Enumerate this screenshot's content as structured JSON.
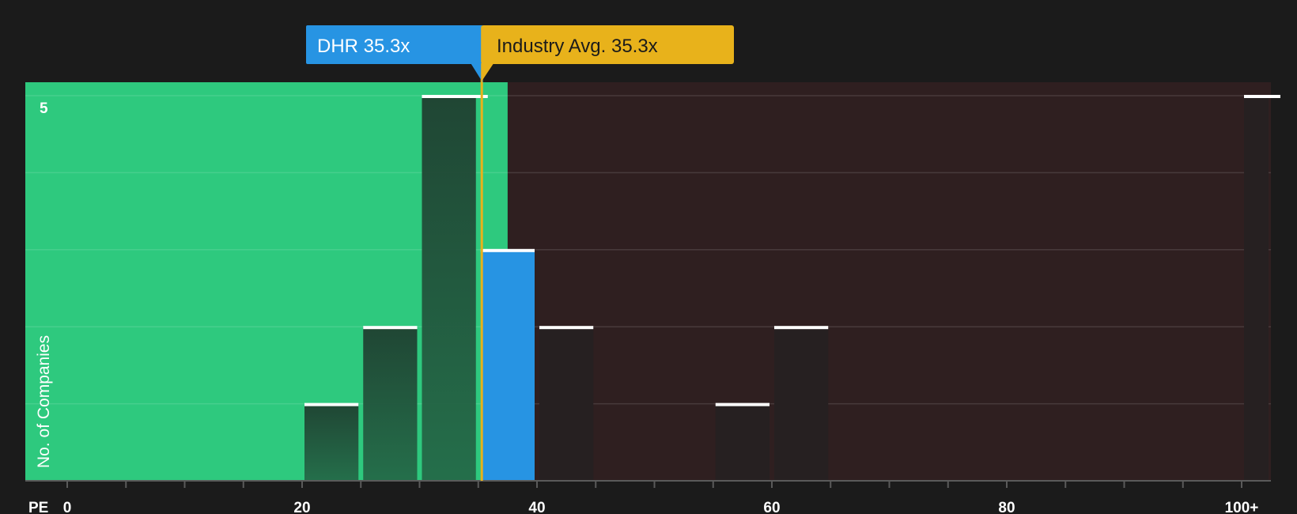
{
  "chart_data": {
    "type": "bar",
    "title": "",
    "xlabel": "PE",
    "ylabel": "No. of Companies",
    "xlim": [
      0,
      103
    ],
    "ylim": [
      0,
      5
    ],
    "x_ticks": [
      {
        "value": 0,
        "label": "0"
      },
      {
        "value": 20,
        "label": "20"
      },
      {
        "value": 40,
        "label": "40"
      },
      {
        "value": 60,
        "label": "60"
      },
      {
        "value": 80,
        "label": "80"
      },
      {
        "value": 100,
        "label": "100+"
      }
    ],
    "y_ticks": [
      {
        "value": 5,
        "label": "5"
      }
    ],
    "grid": true,
    "bin_width": 5,
    "bins": [
      {
        "start": 20,
        "end": 25,
        "count": 1
      },
      {
        "start": 25,
        "end": 30,
        "count": 2
      },
      {
        "start": 30,
        "end": 35,
        "count": 5
      },
      {
        "start": 35,
        "end": 40,
        "count": 3,
        "highlight": true
      },
      {
        "start": 40,
        "end": 45,
        "count": 2
      },
      {
        "start": 55,
        "end": 60,
        "count": 1
      },
      {
        "start": 60,
        "end": 65,
        "count": 2
      },
      {
        "start": 100,
        "end": 103,
        "count": 5
      }
    ],
    "company": {
      "label": "DHR 35.3x",
      "value": 35.3
    },
    "industry_avg": {
      "label": "Industry Avg. 35.3x",
      "value": 35.3
    },
    "green_zone_end": 37.5
  },
  "colors": {
    "background": "#1b1b1b",
    "undervalued_zone": "#2ec97e",
    "overvalued_zone": "#2f1f20",
    "company_bar": "#2794e3",
    "industry_line": "#e8b21b",
    "bar_on_green": "#1f4d36",
    "bar_on_dark": "#262021",
    "cap": "#ffffff",
    "text": "#ffffff",
    "label_dark_text": "#1b1b1b",
    "axis_tick": "#5a5a5a"
  }
}
